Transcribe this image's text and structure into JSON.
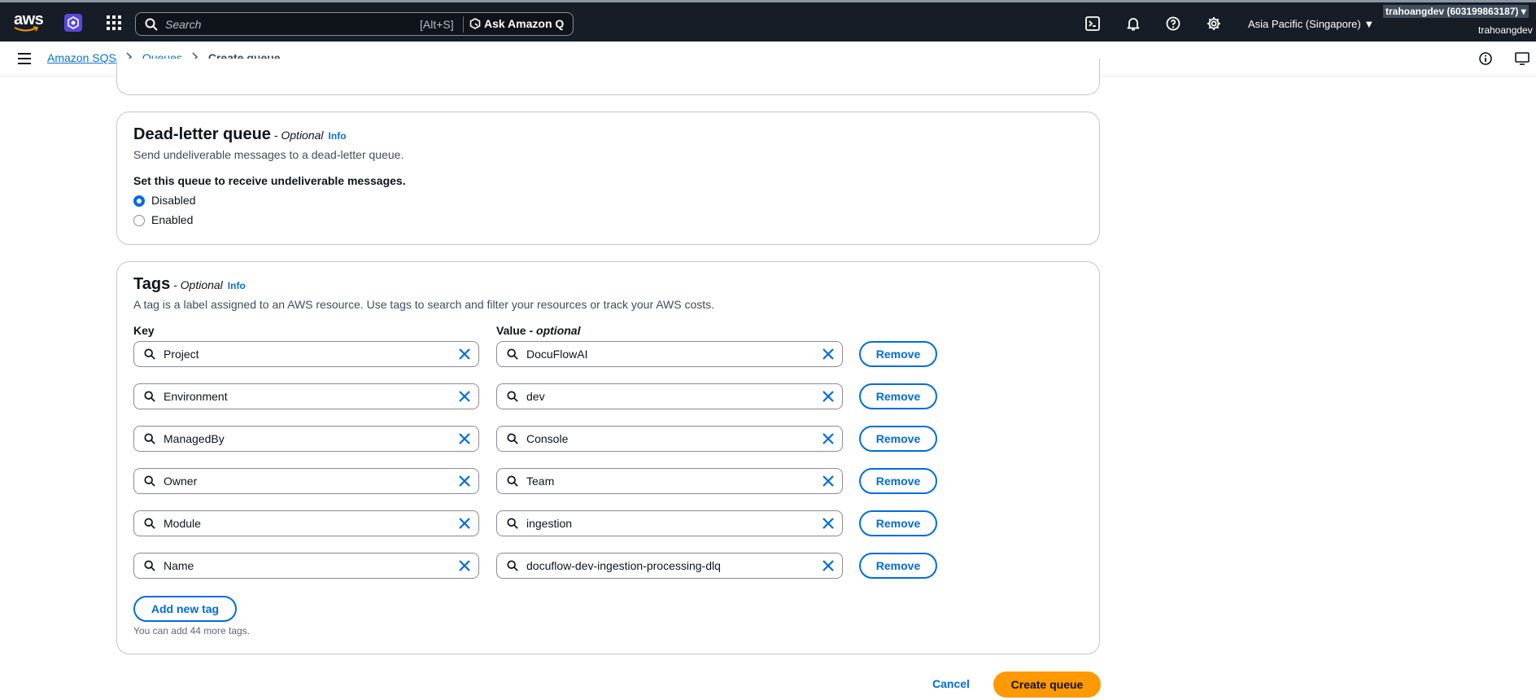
{
  "topnav": {
    "logo_text": "aws",
    "search_placeholder": "Search",
    "search_shortcut": "[Alt+S]",
    "ask_q_label": "Ask Amazon Q",
    "region_label": "Asia Pacific (Singapore) ▼",
    "account_badge": "trahoangdev (603199863187) ▾",
    "user_label": "trahoangdev"
  },
  "breadcrumb": {
    "items": [
      "Amazon SQS",
      "Queues"
    ],
    "current": "Create queue"
  },
  "dead_letter": {
    "title": "Dead-letter queue",
    "optional": " - Optional",
    "info": "Info",
    "description": "Send undeliverable messages to a dead-letter queue.",
    "question": "Set this queue to receive undeliverable messages.",
    "options": [
      "Disabled",
      "Enabled"
    ],
    "selected": "Disabled"
  },
  "tags": {
    "title": "Tags",
    "optional": " - Optional",
    "info": "Info",
    "description": "A tag is a label assigned to an AWS resource. Use tags to search and filter your resources or track your AWS costs.",
    "key_header": "Key",
    "value_header": "Value",
    "value_optional": " - optional",
    "remove_label": "Remove",
    "rows": [
      {
        "key": "Project",
        "value": "DocuFlowAI"
      },
      {
        "key": "Environment",
        "value": "dev"
      },
      {
        "key": "ManagedBy",
        "value": "Console"
      },
      {
        "key": "Owner",
        "value": "Team"
      },
      {
        "key": "Module",
        "value": "ingestion"
      },
      {
        "key": "Name",
        "value": "docuflow-dev-ingestion-processing-dlq"
      }
    ],
    "add_label": "Add new tag",
    "limit_hint": "You can add 44 more tags."
  },
  "footer": {
    "cancel_label": "Cancel",
    "create_label": "Create queue"
  },
  "colors": {
    "nav_bg": "#161d26",
    "link": "#0972d3",
    "primary_button": "#ff9900",
    "outline_button": "#006ce0"
  }
}
